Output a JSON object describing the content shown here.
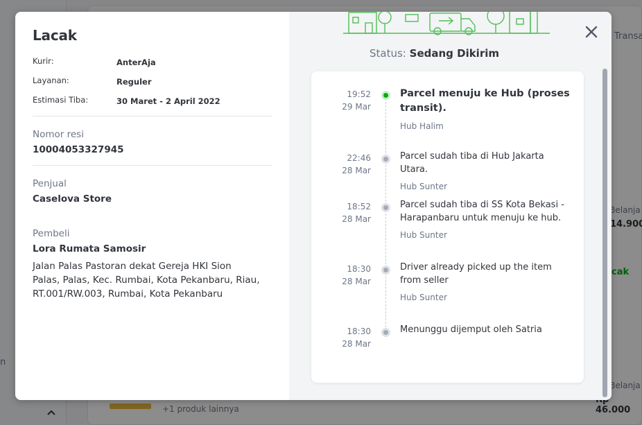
{
  "background": {
    "right_snippets": [
      "Transa",
      "l Belanja",
      "14.900",
      "cak",
      "l Belanja",
      "Rp 46.000"
    ],
    "left_snippet": "n",
    "bottom_more": "+1 produk lainnya"
  },
  "modal": {
    "title": "Lacak",
    "info": [
      {
        "label": "Kurir:",
        "value": "AnterAja"
      },
      {
        "label": "Layanan:",
        "value": "Reguler"
      },
      {
        "label": "Estimasi Tiba:",
        "value": "30 Maret - 2 April 2022"
      }
    ],
    "resi": {
      "label": "Nomor resi",
      "value": "10004053327945"
    },
    "seller": {
      "label": "Penjual",
      "value": "Caselova Store"
    },
    "buyer": {
      "label": "Pembeli",
      "name": "Lora Rumata Samosir",
      "address": "Jalan Palas Pastoran dekat Gereja HKI Sion Palas, Palas, Kec. Rumbai, Kota Pekanbaru, Riau, RT.001/RW.003, Rumbai, Kota Pekanbaru"
    },
    "status": {
      "prefix": "Status:",
      "value": "Sedang Dikirim"
    },
    "close_icon": "close-icon",
    "accent_color": "#03ac0e",
    "timeline": [
      {
        "time": "19:52",
        "date": "29 Mar",
        "title": "Parcel menuju ke Hub (proses transit).",
        "hub": "Hub Halim",
        "active": true
      },
      {
        "time": "22:46",
        "date": "28 Mar",
        "title": "Parcel sudah tiba di Hub Jakarta Utara.",
        "hub": "Hub Sunter",
        "active": false
      },
      {
        "time": "18:52",
        "date": "28 Mar",
        "title": "Parcel sudah tiba di SS Kota Bekasi - Harapanbaru untuk menuju ke hub.",
        "hub": "Hub Sunter",
        "active": false
      },
      {
        "time": "18:30",
        "date": "28 Mar",
        "title": "Driver already picked up the item from seller",
        "hub": "Hub Sunter",
        "active": false
      },
      {
        "time": "18:30",
        "date": "28 Mar",
        "title": "Menunggu dijemput oleh Satria",
        "hub": "",
        "active": false
      }
    ]
  }
}
